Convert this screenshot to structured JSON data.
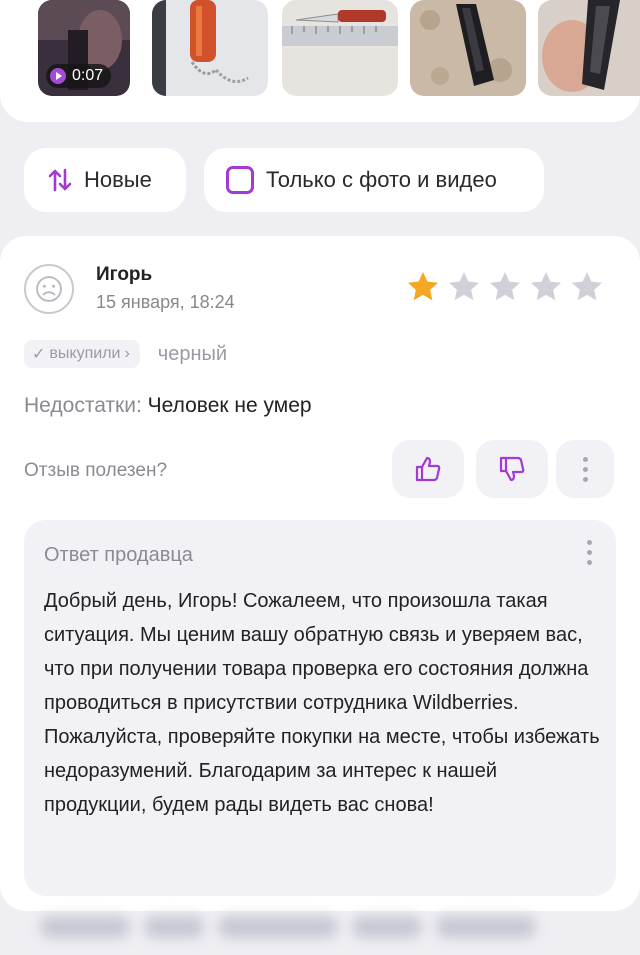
{
  "media": {
    "video_duration": "0:07",
    "thumbnails": [
      {
        "name": "video-thumb",
        "kind": "video"
      },
      {
        "name": "photo-knife-keychain",
        "kind": "photo"
      },
      {
        "name": "photo-knife-ruler",
        "kind": "photo"
      },
      {
        "name": "photo-knife-folded",
        "kind": "photo"
      },
      {
        "name": "photo-knife-in-hand",
        "kind": "photo"
      }
    ]
  },
  "filters": {
    "sort_label": "Новые",
    "media_only_label": "Только с фото и видео"
  },
  "review": {
    "author": "Игорь",
    "date": "15 января, 18:24",
    "rating": 1,
    "rating_max": 5,
    "bought_label": "выкупили",
    "variant": "черный",
    "cons_label": "Недостатки:",
    "cons_text": "Человек не умер",
    "helpful_label": "Отзыв полезен?"
  },
  "seller_reply": {
    "title": "Ответ продавца",
    "text": "Добрый день, Игорь! Сожалеем, что произошла такая ситуация. Мы ценим вашу обратную связь и уверяем вас, что при получении товара проверка его состояния должна проводиться в присутствии сотрудника Wildberries. Пожалуйста, проверяйте покупки на месте, чтобы избежать недоразумений. Благодарим за интерес к нашей продукции, будем рады видеть вас снова!"
  },
  "colors": {
    "accent_purple": "#a13bd3",
    "star_filled": "#f5a623",
    "star_empty": "#d0d0d8",
    "page_bg": "#eeeef3"
  },
  "icons": {
    "sort": "sort-arrows-icon",
    "checkbox": "checkbox-icon",
    "like": "thumb-up-icon",
    "dislike": "thumb-down-icon",
    "more": "more-vertical-icon",
    "avatar": "sad-face-icon",
    "play": "play-icon"
  }
}
